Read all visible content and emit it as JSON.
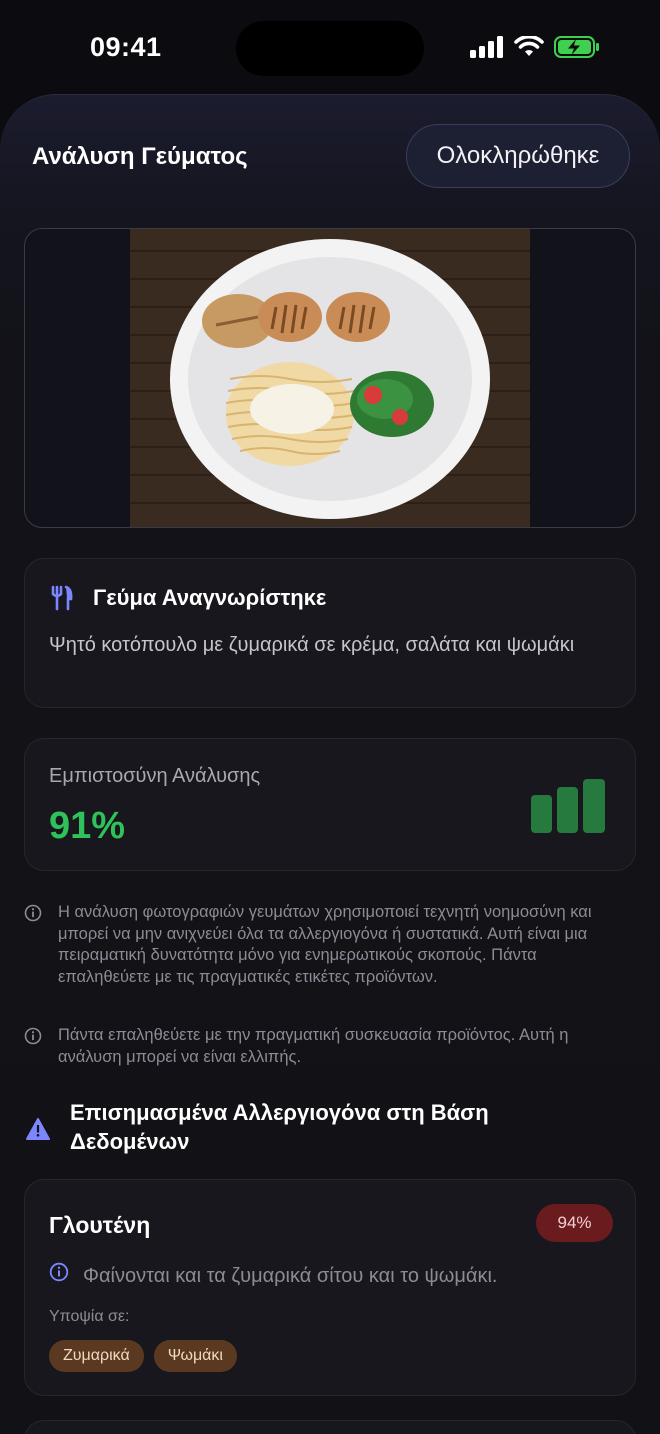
{
  "status_bar": {
    "time": "09:41"
  },
  "header": {
    "title": "Ανάλυση Γεύματος",
    "done_label": "Ολοκληρώθηκε"
  },
  "meal": {
    "icon": "fork-knife-icon",
    "title": "Γεύμα Αναγνωρίστηκε",
    "description": "Ψητό κοτόπουλο με ζυμαρικά σε κρέμα, σαλάτα και ψωμάκι"
  },
  "confidence": {
    "label": "Εμπιστοσύνη Ανάλυσης",
    "value": "91%",
    "color": "#2fc15a"
  },
  "notes": [
    "Η ανάλυση φωτογραφιών γευμάτων χρησιμοποιεί τεχνητή νοημοσύνη και μπορεί να μην ανιχνεύει όλα τα αλλεργιογόνα ή συστατικά. Αυτή είναι μια πειραματική δυνατότητα μόνο για ενημερωτικούς σκοπούς. Πάντα επαληθεύετε με τις πραγματικές ετικέτες προϊόντων.",
    "Πάντα επαληθεύετε με την πραγματική συσκευασία προϊόντος. Αυτή η ανάλυση μπορεί να είναι ελλιπής."
  ],
  "allergens_section": {
    "title": "Επισημασμένα Αλλεργιογόνα στη Βάση Δεδομένων"
  },
  "allergens": [
    {
      "name": "Γλουτένη",
      "percent": "94%",
      "note": "Φαίνονται και τα ζυμαρικά σίτου και το ψωμάκι.",
      "suspect_label": "Υποψία σε:",
      "tags": [
        "Ζυμαρικά",
        "Ψωμάκι"
      ]
    }
  ]
}
